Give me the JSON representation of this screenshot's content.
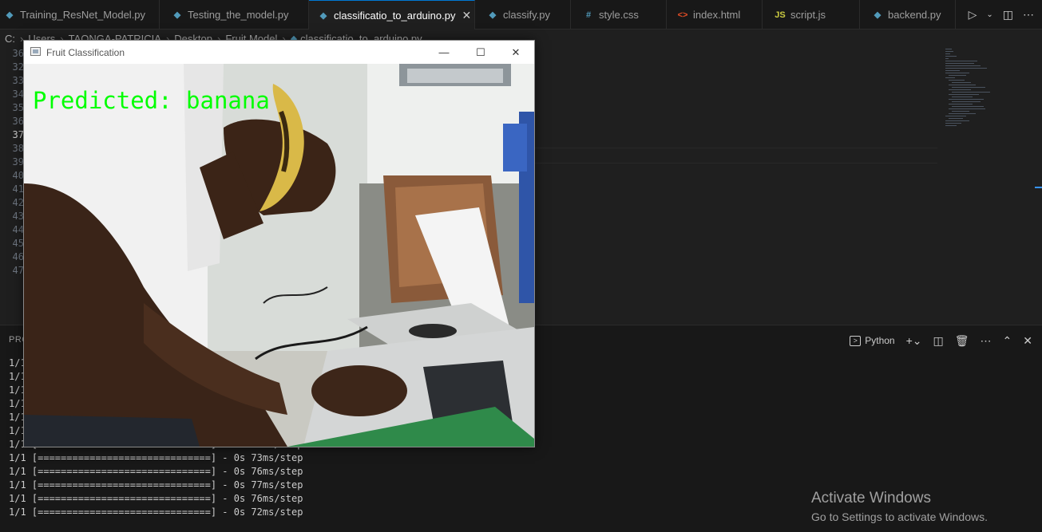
{
  "tabs": [
    {
      "label": "Training_ResNet_Model.py",
      "icon": "python-file-icon"
    },
    {
      "label": "Testing_the_model.py",
      "icon": "python-file-icon"
    },
    {
      "label": "classificatio_to_arduino.py",
      "icon": "python-file-icon",
      "active": true
    },
    {
      "label": "classify.py",
      "icon": "python-file-icon"
    },
    {
      "label": "style.css",
      "icon": "css-file-icon"
    },
    {
      "label": "index.html",
      "icon": "html-file-icon"
    },
    {
      "label": "script.js",
      "icon": "js-file-icon"
    },
    {
      "label": "backend.py",
      "icon": "python-file-icon"
    }
  ],
  "breadcrumb": [
    "C:",
    "Users",
    "TAONGA-PATRICIA",
    "Desktop",
    "Fruit Model",
    "classificatio_to_arduino.py"
  ],
  "editor": {
    "line_numbers": [
      "36",
      "32",
      "33",
      "34",
      "35",
      "36",
      "37",
      "38",
      "39",
      "40",
      "41",
      "42",
      "43",
      "44",
      "45",
      "46",
      "47"
    ],
    "current_line": "37"
  },
  "panel": {
    "title": "PROBLEMS",
    "terminal_label": "Python",
    "terminal_lines": [
      "1/1 [==============================] - 0s 75ms/step",
      "1/1 [==============================] - 0s 74ms/step",
      "1/1 [==============================] - 0s 72ms/step",
      "1/1 [==============================] - 0s 78ms/step",
      "1/1 [==============================] - 0s 75ms/step",
      "1/1 [==============================] - 0s 74ms/step",
      "1/1 [==============================] - 0s 77ms/step",
      "1/1 [==============================] - 0s 73ms/step",
      "1/1 [==============================] - 0s 76ms/step",
      "1/1 [==============================] - 0s 77ms/step",
      "1/1 [==============================] - 0s 76ms/step",
      "1/1 [==============================] - 0s 72ms/step"
    ]
  },
  "cv_window": {
    "title": "Fruit Classification",
    "prediction": "Predicted: banana"
  },
  "watermark": {
    "line1": "Activate Windows",
    "line2": "Go to Settings to activate Windows."
  },
  "colors": {
    "accent": "#0078d4",
    "prediction_text": "#00ff00"
  }
}
